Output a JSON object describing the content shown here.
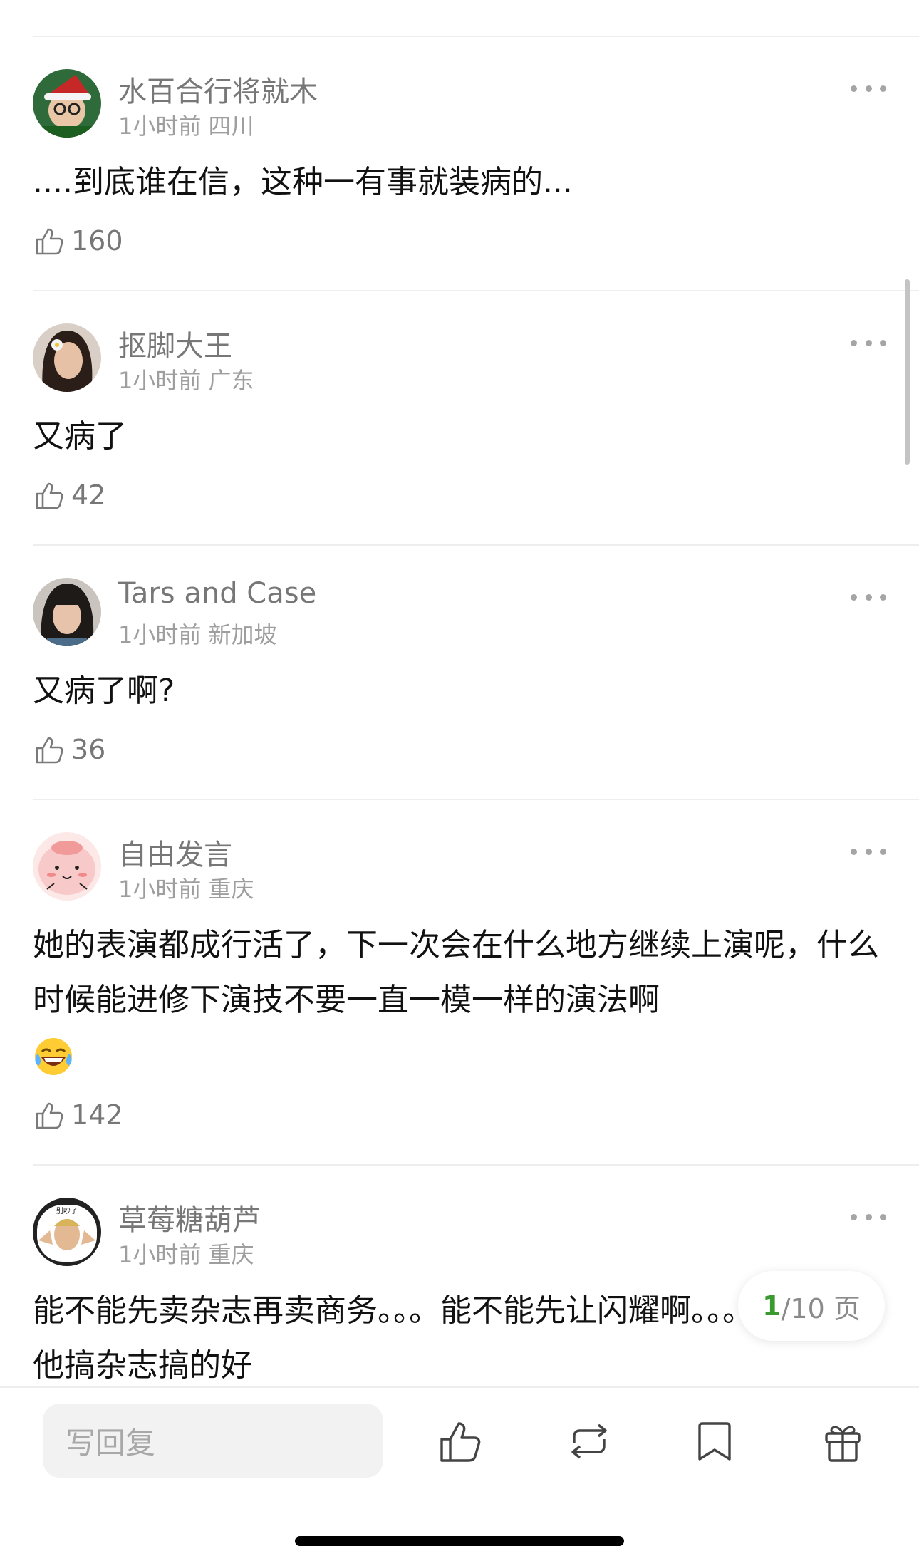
{
  "comments": [
    {
      "username": "水百合行将就木",
      "time": "1小时前",
      "location": "四川",
      "text": "....到底谁在信，这种一有事就装病的...",
      "likes": "160",
      "avatar": "christmas-hat-glasses-avatar"
    },
    {
      "username": "抠脚大王",
      "time": "1小时前",
      "location": "广东",
      "text": "又病了",
      "likes": "42",
      "avatar": "woman-with-flower-avatar"
    },
    {
      "username": "Tars and Case",
      "time": "1小时前",
      "location": "新加坡",
      "text": "又病了啊?",
      "likes": "36",
      "avatar": "dark-haired-woman-avatar"
    },
    {
      "username": "自由发言",
      "time": "1小时前",
      "location": "重庆",
      "text": "她的表演都成行活了，下一次会在什么地方继续上演呢，什么时候能进修下演技不要一直一模一样的演法啊",
      "emoji": "laughing-tears-emoji",
      "likes": "142",
      "avatar": "pink-cartoon-avatar"
    },
    {
      "username": "草莓糖葫芦",
      "time": "1小时前",
      "location": "重庆",
      "text": "能不能先卖杂志再卖商务。。。能不能先让闪耀啊。。。他搞杂志搞的好",
      "avatar": "meme-man-avatar",
      "avatar_text": "别吵了"
    }
  ],
  "pager": {
    "current": "1",
    "total": "/10 页"
  },
  "bottom_bar": {
    "reply_placeholder": "写回复",
    "icons": [
      "like-icon",
      "repost-icon",
      "bookmark-icon",
      "gift-icon"
    ]
  },
  "colors": {
    "accent": "#3b9a2f",
    "muted": "#9e9e9e"
  }
}
